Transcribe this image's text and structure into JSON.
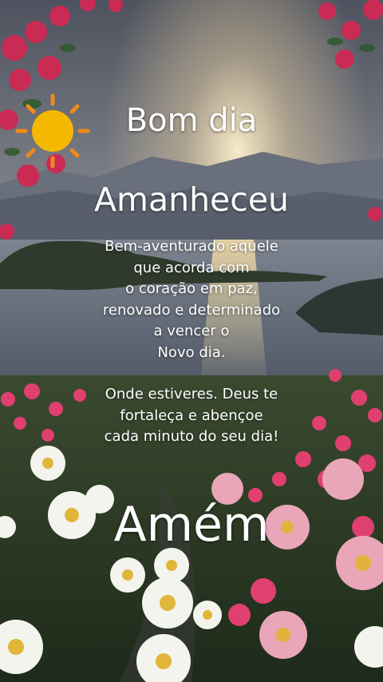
{
  "card": {
    "greeting": "Bom dia",
    "headline": "Amanheceu",
    "message_lines": [
      "Bem-aventurado aquele",
      "que acorda com",
      "o coração em paz,",
      "renovado e determinado",
      "a vencer o",
      "Novo dia.",
      "",
      "Onde estiveres. Deus te",
      "fortaleça e abençoe",
      "cada minuto do seu dia!"
    ],
    "closing": "Amém"
  },
  "icons": {
    "sun": "sun-icon"
  },
  "colors": {
    "sun": "#f5b800",
    "sun_rays": "#f08a1c",
    "text": "#ffffff",
    "sky_top": "#5a5f6a",
    "sea": "#6f7680",
    "roses": "#d6335c",
    "daisy": "#f4f4ee"
  }
}
